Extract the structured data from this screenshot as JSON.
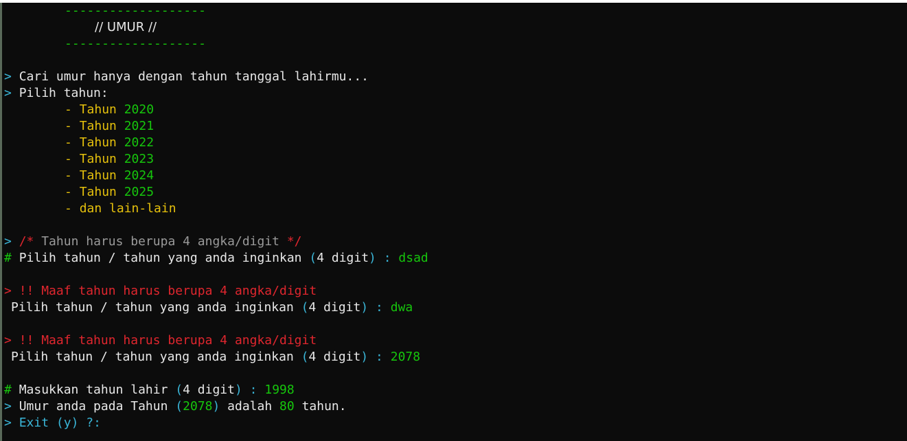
{
  "banner": {
    "dashes_top": "-------------------",
    "title": "// UMUR //",
    "dashes_bottom": "-------------------"
  },
  "prompt_char": ">",
  "hash_char": "#",
  "intro": {
    "line1": "Cari umur hanya dengan tahun tanggal lahirmu...",
    "line2": "Pilih tahun:"
  },
  "years": [
    {
      "label": "Tahun",
      "year": "2020"
    },
    {
      "label": "Tahun",
      "year": "2021"
    },
    {
      "label": "Tahun",
      "year": "2022"
    },
    {
      "label": "Tahun",
      "year": "2023"
    },
    {
      "label": "Tahun",
      "year": "2024"
    },
    {
      "label": "Tahun",
      "year": "2025"
    }
  ],
  "dash": "-",
  "others": "dan lain-lain",
  "comment": {
    "open": "/*",
    "text": "Tahun harus berupa 4 angka/digit",
    "close": "*/"
  },
  "ask": {
    "text": "Pilih tahun / tahun yang anda inginkan",
    "open_paren": "(",
    "digits": "4 digit",
    "close_paren": ")",
    "colon": ":"
  },
  "attempts": [
    "dsad",
    "dwa",
    "2078"
  ],
  "error": "!! Maaf tahun harus berupa 4 angka/digit",
  "birth": {
    "text": "Masukkan tahun lahir",
    "value": "1998"
  },
  "result": {
    "prefix": "Umur anda pada Tahun",
    "year": "2078",
    "middle": "adalah",
    "age": "80",
    "suffix": "tahun."
  },
  "exit": {
    "text": "Exit",
    "option": "(y)",
    "question": "?:"
  }
}
